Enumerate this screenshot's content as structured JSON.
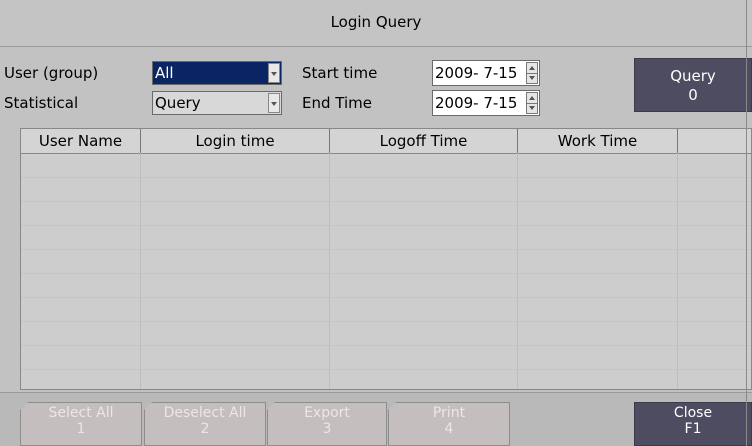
{
  "window": {
    "title": "Login Query"
  },
  "filters": {
    "user_group_label": "User (group)",
    "user_group_value": "All",
    "statistical_label": "Statistical",
    "statistical_value": "Query",
    "start_time_label": "Start time",
    "start_time_value": "2009- 7-15",
    "end_time_label": "End Time",
    "end_time_value": "2009- 7-15"
  },
  "query_button": {
    "label": "Query",
    "shortcut": "0"
  },
  "table": {
    "columns": [
      "User Name",
      "Login time",
      "Logoff Time",
      "Work Time",
      ""
    ],
    "rows": []
  },
  "toolbar": {
    "buttons": [
      {
        "label": "Select All",
        "shortcut": "1"
      },
      {
        "label": "Deselect All",
        "shortcut": "2"
      },
      {
        "label": "Export",
        "shortcut": "3"
      },
      {
        "label": "Print",
        "shortcut": "4"
      }
    ],
    "close": {
      "label": "Close",
      "shortcut": "F1"
    }
  },
  "colors": {
    "active_select": "#0a2464",
    "dark_button": "#4d4c61",
    "disabled_button": "#c4bebe"
  }
}
